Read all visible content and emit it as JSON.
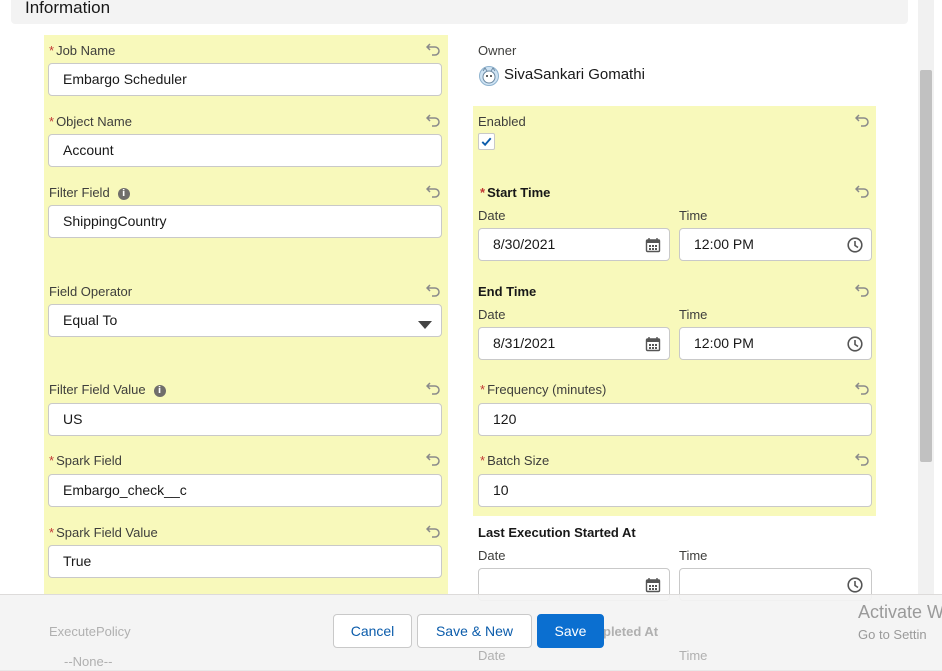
{
  "section": {
    "title": "Information"
  },
  "left": {
    "job_name": {
      "label": "Job Name",
      "value": "Embargo Scheduler"
    },
    "object_name": {
      "label": "Object Name",
      "value": "Account"
    },
    "filter_field": {
      "label": "Filter Field",
      "value": "ShippingCountry"
    },
    "field_operator": {
      "label": "Field Operator",
      "value": "Equal To"
    },
    "filter_field_value": {
      "label": "Filter Field Value",
      "value": "US"
    },
    "spark_field": {
      "label": "Spark Field",
      "value": "Embargo_check__c"
    },
    "spark_field_value": {
      "label": "Spark Field Value",
      "value": "True"
    },
    "execute_policy": {
      "label": "ExecutePolicy",
      "value": "--None--"
    }
  },
  "right": {
    "owner": {
      "label": "Owner",
      "value": "SivaSankari Gomathi"
    },
    "enabled": {
      "label": "Enabled",
      "checked": true
    },
    "start_time": {
      "label": "Start Time",
      "date_label": "Date",
      "date": "8/30/2021",
      "time_label": "Time",
      "time": "12:00 PM"
    },
    "end_time": {
      "label": "End Time",
      "date_label": "Date",
      "date": "8/31/2021",
      "time_label": "Time",
      "time": "12:00 PM"
    },
    "frequency": {
      "label": "Frequency (minutes)",
      "value": "120"
    },
    "batch_size": {
      "label": "Batch Size",
      "value": "10"
    },
    "last_started": {
      "label": "Last Execution Started At",
      "date_label": "Date",
      "date": "",
      "time_label": "Time",
      "time": ""
    },
    "last_completed": {
      "label": "pleted At",
      "date_label": "Date",
      "time_label": "Time"
    }
  },
  "footer": {
    "cancel": "Cancel",
    "save_new": "Save & New",
    "save": "Save"
  },
  "watermark": {
    "line1": "Activate W",
    "line2": "Go to Settin"
  },
  "colors": {
    "highlight": "#f8f9bb",
    "brand": "#0b6fd0",
    "link": "#0b5cab",
    "required": "#c23934"
  }
}
